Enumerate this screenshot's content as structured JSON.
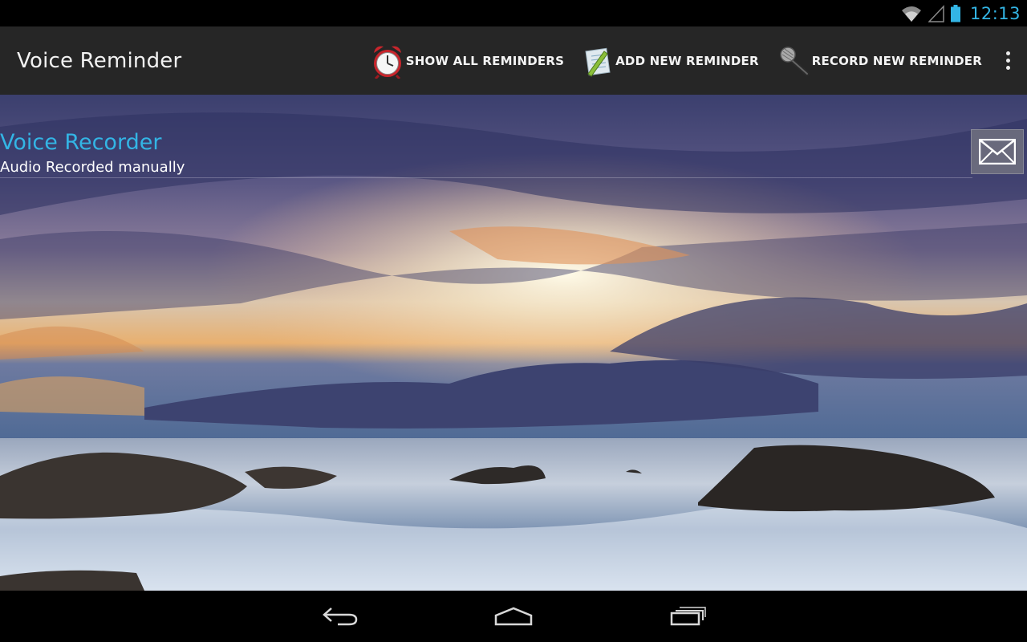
{
  "status_bar": {
    "time": "12:13",
    "icons": [
      "wifi-icon",
      "signal-icon",
      "battery-icon"
    ]
  },
  "action_bar": {
    "title": "Voice Reminder",
    "actions": [
      {
        "label": "SHOW ALL REMINDERS",
        "icon": "alarm-clock-icon"
      },
      {
        "label": "ADD NEW REMINDER",
        "icon": "notepad-icon"
      },
      {
        "label": "RECORD NEW REMINDER",
        "icon": "microphone-icon"
      }
    ],
    "overflow_icon": "overflow-menu-icon"
  },
  "reminders": [
    {
      "title": "Voice Recorder",
      "subtitle": "Audio Recorded manually",
      "action_icon": "mail-icon"
    }
  ],
  "nav_bar": {
    "icons": [
      "back-icon",
      "home-icon",
      "recent-apps-icon"
    ]
  },
  "colors": {
    "accent": "#33b5e5",
    "action_bar": "#262626",
    "status_bar": "#000000"
  }
}
